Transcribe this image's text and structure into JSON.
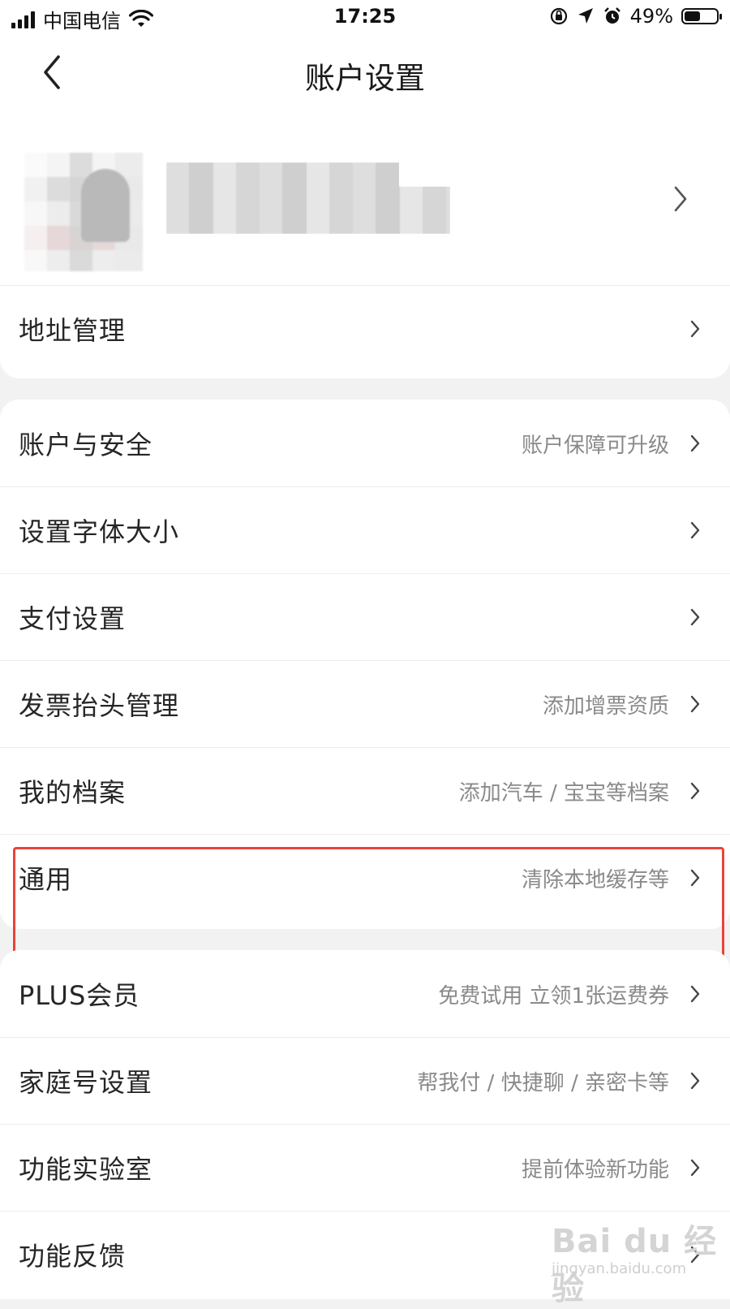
{
  "status_bar": {
    "carrier": "中国电信",
    "time": "17:25",
    "battery_percent": "49%",
    "battery_level": 0.49,
    "icons": [
      "signal-icon",
      "wifi-icon",
      "rotation-lock-icon",
      "location-icon",
      "alarm-icon",
      "battery-icon"
    ]
  },
  "nav": {
    "title": "账户设置",
    "back_icon": "chevron-left-icon"
  },
  "sections": [
    {
      "items": [
        {
          "label": "地址管理",
          "hint": ""
        }
      ]
    },
    {
      "items": [
        {
          "label": "账户与安全",
          "hint": "账户保障可升级"
        },
        {
          "label": "设置字体大小",
          "hint": ""
        },
        {
          "label": "支付设置",
          "hint": ""
        },
        {
          "label": "发票抬头管理",
          "hint": "添加增票资质"
        },
        {
          "label": "我的档案",
          "hint": "添加汽车 / 宝宝等档案"
        },
        {
          "label": "通用",
          "hint": "清除本地缓存等"
        }
      ]
    },
    {
      "items": [
        {
          "label": "PLUS会员",
          "hint": "免费试用 立领1张运费券"
        },
        {
          "label": "家庭号设置",
          "hint": "帮我付 / 快捷聊 / 亲密卡等"
        },
        {
          "label": "功能实验室",
          "hint": "提前体验新功能"
        },
        {
          "label": "功能反馈",
          "hint": ""
        }
      ]
    }
  ],
  "watermark": {
    "main": "Bai du 经验",
    "sub": "jingyan.baidu.com"
  },
  "colors": {
    "highlight_border": "#e8443a",
    "page_background": "#f2f2f2",
    "hint_text": "#8a8a8a"
  }
}
